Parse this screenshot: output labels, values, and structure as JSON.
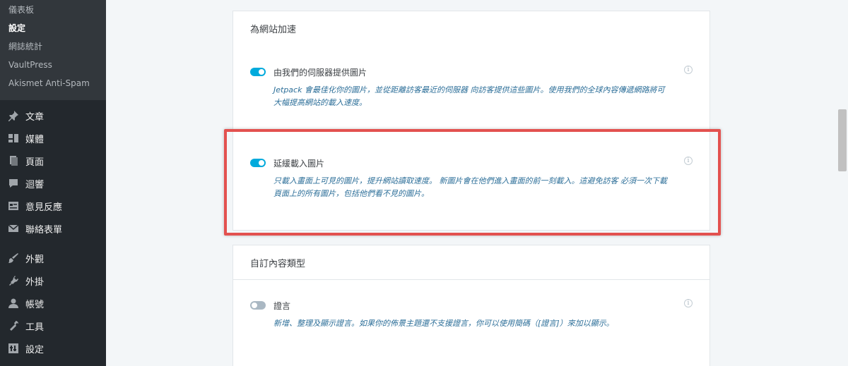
{
  "sidebar": {
    "submenu": [
      {
        "label": "儀表板",
        "current": false
      },
      {
        "label": "設定",
        "current": true
      },
      {
        "label": "網誌統計",
        "current": false
      },
      {
        "label": "VaultPress",
        "current": false
      },
      {
        "label": "Akismet Anti-Spam",
        "current": false
      }
    ],
    "items": [
      {
        "label": "文章",
        "icon": "pushpin-icon"
      },
      {
        "label": "媒體",
        "icon": "media-icon"
      },
      {
        "label": "頁面",
        "icon": "page-icon"
      },
      {
        "label": "迴響",
        "icon": "comment-icon"
      },
      {
        "label": "意見反應",
        "icon": "feedback-icon"
      },
      {
        "label": "聯絡表單",
        "icon": "mail-icon"
      },
      {
        "label": "外觀",
        "icon": "paintbrush-icon"
      },
      {
        "label": "外掛",
        "icon": "plugin-icon"
      },
      {
        "label": "帳號",
        "icon": "user-icon"
      },
      {
        "label": "工具",
        "icon": "wrench-icon"
      },
      {
        "label": "設定",
        "icon": "settings-icon"
      }
    ]
  },
  "speed_section": {
    "title": "為網站加速",
    "cdn": {
      "title": "由我們的伺服器提供圖片",
      "desc": "Jetpack 會最佳化你的圖片，並從距離訪客最近的伺服器 向訪客提供這些圖片。使用我們的全球內容傳遞網路將可大幅提高網站的載入速度。",
      "enabled": true
    },
    "lazy": {
      "title": "延緩載入圖片",
      "desc": "只載入畫面上可見的圖片，提升網站讀取速度。 新圖片會在他們進入畫面的前一刻載入。這避免訪客 必須一次下載頁面上的所有圖片，包括他們看不見的圖片。",
      "enabled": true
    }
  },
  "cpt_section": {
    "title": "自訂內容類型",
    "testimonials": {
      "title": "證言",
      "desc": "新增、整理及顯示證言。如果你的佈景主題還不支援證言，你可以使用簡碼（[證言]）來加以顯示。",
      "enabled": false
    }
  },
  "colors": {
    "toggle_on": "#00aadc",
    "toggle_off": "#aab8c3",
    "highlight": "#e3514f"
  }
}
